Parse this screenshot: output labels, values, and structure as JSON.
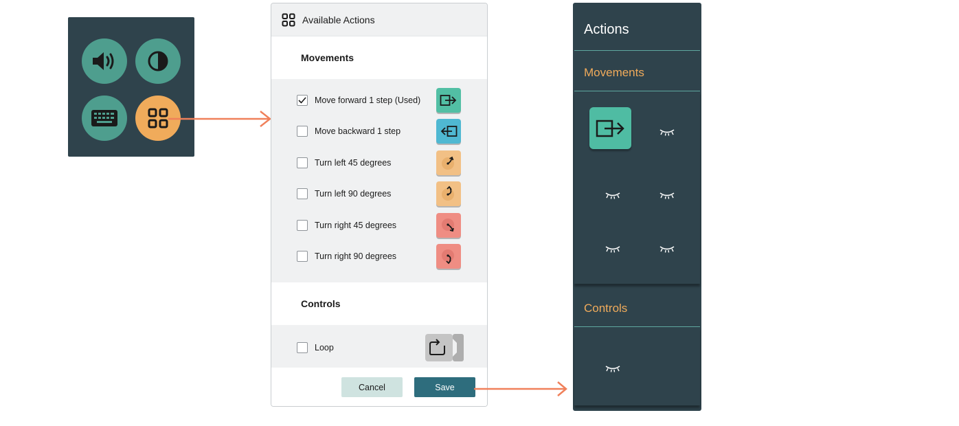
{
  "toolbar": {
    "buttons": [
      {
        "name": "sound",
        "icon": "speaker-icon"
      },
      {
        "name": "contrast",
        "icon": "contrast-icon"
      },
      {
        "name": "keyboard",
        "icon": "keyboard-icon"
      },
      {
        "name": "actions",
        "icon": "grid-icon"
      }
    ]
  },
  "dialog": {
    "title": "Available Actions",
    "movements": {
      "heading": "Movements",
      "items": [
        {
          "label": "Move forward 1 step (Used)",
          "checked": true,
          "icon": "move-forward-icon",
          "color": "#52bfa4"
        },
        {
          "label": "Move backward 1 step",
          "checked": false,
          "icon": "move-backward-icon",
          "color": "#4fb8d2"
        },
        {
          "label": "Turn left 45 degrees",
          "checked": false,
          "icon": "turn-left-45-icon",
          "color": "#f2c085"
        },
        {
          "label": "Turn left 90 degrees",
          "checked": false,
          "icon": "turn-left-90-icon",
          "color": "#f2c085"
        },
        {
          "label": "Turn right 45 degrees",
          "checked": false,
          "icon": "turn-right-45-icon",
          "color": "#ef8d83"
        },
        {
          "label": "Turn right 90 degrees",
          "checked": false,
          "icon": "turn-right-90-icon",
          "color": "#ef8d83"
        }
      ]
    },
    "controls": {
      "heading": "Controls",
      "items": [
        {
          "label": "Loop",
          "checked": false,
          "icon": "loop-icon",
          "color": "#c9c9c9"
        }
      ]
    },
    "cancel_label": "Cancel",
    "save_label": "Save"
  },
  "panel": {
    "title": "Actions",
    "movements_heading": "Movements",
    "controls_heading": "Controls",
    "movement_slots": [
      "move-forward-icon",
      "hidden-eye-icon",
      "hidden-eye-icon",
      "hidden-eye-icon",
      "hidden-eye-icon",
      "hidden-eye-icon"
    ],
    "control_slots": [
      "hidden-eye-icon"
    ]
  },
  "colors": {
    "panel_bg": "#2f434c",
    "accent_orange": "#f0ab5b",
    "accent_teal": "#4e9e8e",
    "arrow": "#f0805a",
    "save_button": "#2e6d7d"
  }
}
